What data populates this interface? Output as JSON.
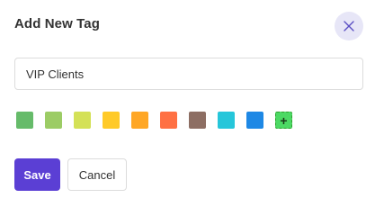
{
  "dialog": {
    "title": "Add New Tag",
    "close_icon": "close-icon"
  },
  "input": {
    "value": "VIP Clients",
    "placeholder": ""
  },
  "colors": {
    "swatches": [
      "#66bb6a",
      "#9ccc65",
      "#d4e157",
      "#ffca28",
      "#ffa726",
      "#ff7043",
      "#8d6e63",
      "#26c6da",
      "#1e88e5"
    ],
    "custom_swatch_color": "#4cd964",
    "custom_swatch_icon": "plus-icon",
    "custom_swatch_symbol": "+"
  },
  "buttons": {
    "save_label": "Save",
    "cancel_label": "Cancel"
  },
  "theme": {
    "accent": "#5b3fd4",
    "close_bg": "#e7e6f7"
  }
}
